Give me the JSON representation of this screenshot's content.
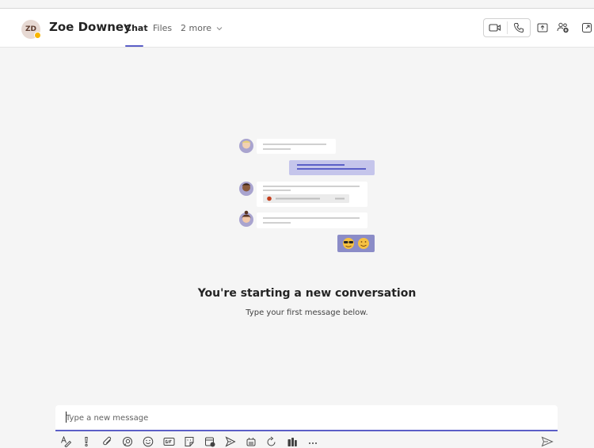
{
  "header": {
    "avatar_initials": "ZD",
    "presence_color": "#f8b500",
    "contact_name": "Zoe Downey",
    "tabs": [
      {
        "label": "Chat",
        "active": true
      },
      {
        "label": "Files",
        "active": false
      },
      {
        "label": "2 more",
        "active": false
      }
    ],
    "actions": [
      "video-call-icon",
      "audio-call-icon",
      "share-screen-icon",
      "add-people-icon",
      "pop-out-icon"
    ]
  },
  "main": {
    "headline": "You're starting a new conversation",
    "subline": "Type your first message below."
  },
  "composer": {
    "placeholder": "Type a new message",
    "toolbar_icons": [
      "format-icon",
      "important-icon",
      "attach-icon",
      "loop-icon",
      "emoji-icon",
      "gif-icon",
      "sticker-icon",
      "schedule-meeting-icon",
      "praise-icon",
      "stream-icon",
      "update-icon",
      "apps-icon",
      "more-options-icon"
    ],
    "send_icon": "send-icon"
  },
  "colors": {
    "accent": "#5b5fc7",
    "bubble_self": "#c5c5eb",
    "background": "#f5f5f5"
  }
}
